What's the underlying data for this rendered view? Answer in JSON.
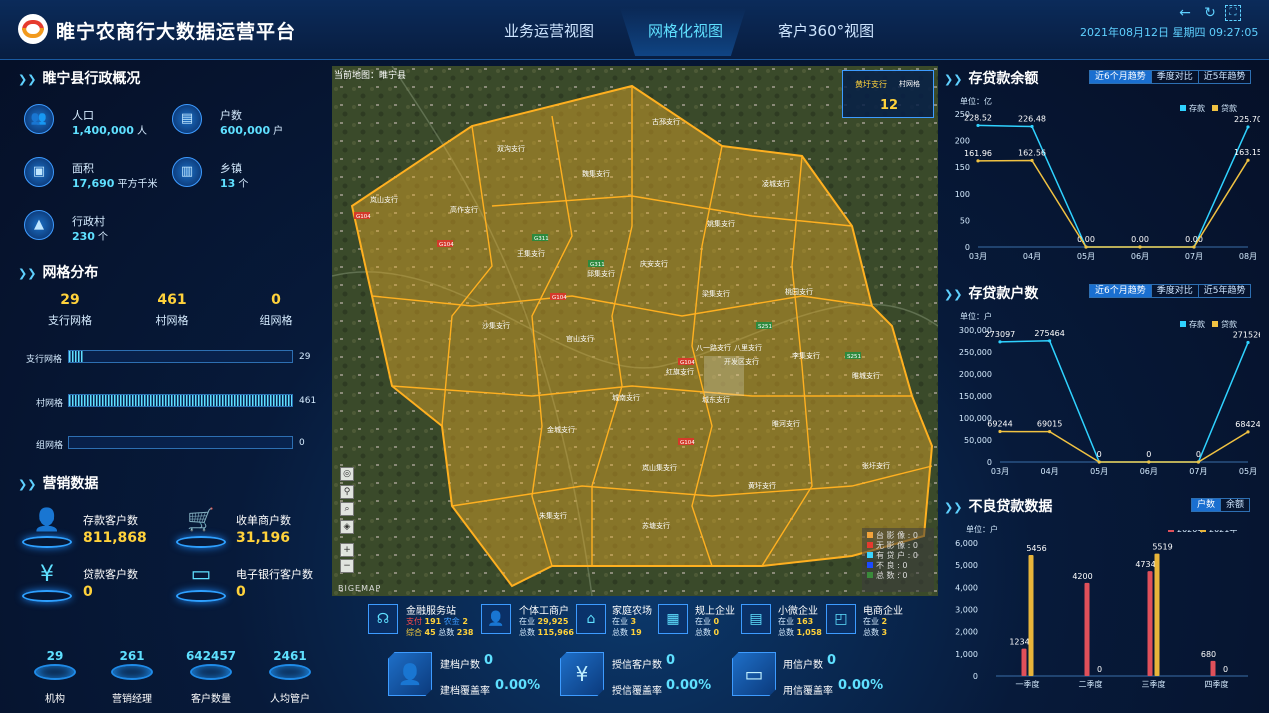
{
  "header": {
    "title": "睢宁农商行大数据运营平台",
    "tabs": [
      {
        "label": "业务运营视图"
      },
      {
        "label": "网格化视图"
      },
      {
        "label": "客户360°视图"
      }
    ],
    "active_tab": 1,
    "datetime": "2021年08月12日 星期四 09:27:05",
    "icons": [
      "back-icon",
      "refresh-icon",
      "fullscreen-icon"
    ]
  },
  "admin": {
    "title": "睢宁县行政概况",
    "stats": [
      {
        "label": "人口",
        "value": "1,400,000",
        "unit": "人",
        "icon": "people-icon"
      },
      {
        "label": "户数",
        "value": "600,000",
        "unit": "户",
        "icon": "household-card-icon"
      },
      {
        "label": "面积",
        "value": "17,690",
        "unit": "平方千米",
        "icon": "area-icon"
      },
      {
        "label": "乡镇",
        "value": "13",
        "unit": "个",
        "icon": "town-icon"
      },
      {
        "label": "行政村",
        "value": "230",
        "unit": "个",
        "icon": "village-icon"
      }
    ]
  },
  "grid": {
    "title": "网格分布",
    "summary": [
      {
        "value": "29",
        "label": "支行网格"
      },
      {
        "value": "461",
        "label": "村网格"
      },
      {
        "value": "0",
        "label": "组网格"
      }
    ],
    "bars": [
      {
        "label": "支行网格",
        "value": 29,
        "display": "29"
      },
      {
        "label": "村网格",
        "value": 461,
        "display": "461"
      },
      {
        "label": "组网格",
        "value": 0,
        "display": "0"
      }
    ],
    "bar_max": 461
  },
  "marketing": {
    "title": "营销数据",
    "items": [
      {
        "label": "存款客户数",
        "value": "811,868",
        "icon": "deposit-customer-icon"
      },
      {
        "label": "收单商户数",
        "value": "31,196",
        "icon": "merchant-icon"
      },
      {
        "label": "贷款客户数",
        "value": "0",
        "icon": "loan-customer-icon"
      },
      {
        "label": "电子银行客户数",
        "value": "0",
        "icon": "e-bank-card-icon"
      }
    ],
    "kpis": [
      {
        "value": "29",
        "label": "机构"
      },
      {
        "value": "261",
        "label": "营销经理"
      },
      {
        "value": "642457",
        "label": "客户数量"
      },
      {
        "value": "2461",
        "label": "人均管户"
      }
    ]
  },
  "map": {
    "caption": "当前地图：睢宁县",
    "box_labels": [
      "黄圩支行",
      "村网格"
    ],
    "box_value": "12",
    "branches": [
      "古邳支行",
      "魏集支行",
      "双沟支行",
      "岚山支行",
      "高作支行",
      "王集支行",
      "庆安支行",
      "姚集支行",
      "凌城支行",
      "邱集支行",
      "沙集支行",
      "梁集支行",
      "桃园支行",
      "官山支行",
      "李集支行",
      "睢城支行",
      "八一路支行",
      "八里支行",
      "开发区支行",
      "红旗支行",
      "城东支行",
      "城南支行",
      "金城支行",
      "睢河支行",
      "岚山集支行",
      "张圩支行",
      "黄圩支行",
      "朱集支行",
      "苏塘支行"
    ],
    "roads": [
      "G104",
      "G311",
      "G311",
      "G104",
      "G104",
      "S251",
      "G104",
      "S251",
      "G104"
    ],
    "legend": [
      {
        "label": "台 影 像",
        "value": "0",
        "color": "#f2a23a"
      },
      {
        "label": "无 影 像",
        "value": "0",
        "color": "#e53a2e"
      },
      {
        "label": "有 贷 户",
        "value": "0",
        "color": "#3ad4ff"
      },
      {
        "label": "不      良",
        "value": "0",
        "color": "#1a4aff"
      },
      {
        "label": "总      数",
        "value": "0",
        "color": "#3a8a3a"
      }
    ],
    "watermark": "BIGEMAP",
    "tool_icons": [
      "locate-icon",
      "pin-icon",
      "search-pin-icon",
      "layers-icon",
      "zoom-in-icon",
      "zoom-out-icon"
    ],
    "zoom_labels": [
      "+",
      "−"
    ]
  },
  "services": [
    {
      "title": "金融服务站",
      "lines": [
        {
          "k1": "支付",
          "v1": "191",
          "k2": "农金",
          "v2": "2"
        },
        {
          "k1": "综合",
          "v1": "45",
          "k2": "总数",
          "v2": "238"
        }
      ],
      "icon": "headset-icon"
    },
    {
      "title": "个体工商户",
      "lines": [
        {
          "k1": "在业",
          "v1": "29,925"
        },
        {
          "k1": "总数",
          "v1": "115,966"
        }
      ],
      "icon": "person-icon"
    },
    {
      "title": "家庭农场",
      "lines": [
        {
          "k1": "在业",
          "v1": "3"
        },
        {
          "k1": "总数",
          "v1": "19"
        }
      ],
      "icon": "farm-icon"
    },
    {
      "title": "规上企业",
      "lines": [
        {
          "k1": "在业",
          "v1": "0"
        },
        {
          "k1": "总数",
          "v1": "0"
        }
      ],
      "icon": "building-icon"
    },
    {
      "title": "小微企业",
      "lines": [
        {
          "k1": "在业",
          "v1": "163"
        },
        {
          "k1": "总数",
          "v1": "1,058"
        }
      ],
      "icon": "small-biz-icon"
    },
    {
      "title": "电商企业",
      "lines": [
        {
          "k1": "在业",
          "v1": "2"
        },
        {
          "k1": "总数",
          "v1": "3"
        }
      ],
      "icon": "shopping-bag-icon"
    }
  ],
  "coverage": [
    {
      "label1": "建档户数",
      "value1": "0",
      "label2": "建档覆盖率",
      "value2": "0.00%",
      "icon": "user-file-icon"
    },
    {
      "label1": "授信客户数",
      "value1": "0",
      "label2": "授信覆盖率",
      "value2": "0.00%",
      "icon": "coins-hand-icon"
    },
    {
      "label1": "用信户数",
      "value1": "0",
      "label2": "用信覆盖率",
      "value2": "0.00%",
      "icon": "card-icon"
    }
  ],
  "deposit_balance": {
    "title": "存贷款余额",
    "buttons": [
      "近6个月趋势",
      "季度对比",
      "近5年趋势"
    ],
    "active": 0,
    "unit": "单位：亿"
  },
  "deposit_households": {
    "title": "存贷款户数",
    "buttons": [
      "近6个月趋势",
      "季度对比",
      "近5年趋势"
    ],
    "active": 0,
    "unit": "单位：户"
  },
  "npl": {
    "title": "不良贷款数据",
    "buttons": [
      "户数",
      "余额"
    ],
    "active": 0,
    "unit": "单位：户"
  },
  "chart_data": [
    {
      "type": "line",
      "categories": [
        "03月",
        "04月",
        "05月",
        "06月",
        "07月",
        "08月"
      ],
      "series": [
        {
          "name": "存款",
          "values": [
            228.52,
            226.48,
            0.0,
            0.0,
            0.0,
            225.7
          ],
          "labels": [
            "228.52",
            "226.48",
            "0.00",
            "0.00",
            "0.00",
            "225.70"
          ],
          "color": "#2fd2ff"
        },
        {
          "name": "贷款",
          "values": [
            161.96,
            162.56,
            0.0,
            0.0,
            0.0,
            163.15
          ],
          "labels": [
            "161.96",
            "162.56",
            "",
            "",
            "",
            "163.15"
          ],
          "color": "#f0c242"
        }
      ],
      "ylim": [
        0,
        250
      ],
      "yticks": [
        "0",
        "50",
        "100",
        "150",
        "200",
        "250"
      ],
      "grid": false,
      "legend": "top-right"
    },
    {
      "type": "line",
      "categories": [
        "03月",
        "04月",
        "05月",
        "06月",
        "07月",
        "05月"
      ],
      "series": [
        {
          "name": "存款",
          "values": [
            273097,
            275464,
            0,
            0,
            0,
            271526
          ],
          "labels": [
            "273097",
            "275464",
            "0",
            "0",
            "0",
            "271526"
          ],
          "color": "#2fd2ff"
        },
        {
          "name": "贷款",
          "values": [
            69244,
            69015,
            0,
            0,
            0,
            68424
          ],
          "labels": [
            "69244",
            "69015",
            "",
            "",
            "",
            "68424"
          ],
          "color": "#f0c242"
        }
      ],
      "ylim": [
        0,
        300000
      ],
      "yticks": [
        "0",
        "50,000",
        "100,000",
        "150,000",
        "200,000",
        "250,000",
        "300,000"
      ],
      "grid": false,
      "legend": "top-right"
    },
    {
      "type": "bar",
      "categories": [
        "一季度",
        "二季度",
        "三季度",
        "四季度"
      ],
      "series": [
        {
          "name": "2020年",
          "values": [
            1234,
            4200,
            4734,
            680
          ],
          "labels": [
            "1234",
            "4200",
            "4734",
            "680"
          ],
          "color": "#e0505a"
        },
        {
          "name": "2021年",
          "values": [
            5456,
            0,
            5519,
            0
          ],
          "labels": [
            "5456",
            "0",
            "5519",
            "0"
          ],
          "color": "#e8b53a"
        }
      ],
      "ylim": [
        0,
        6000
      ],
      "yticks": [
        "0",
        "1,000",
        "2,000",
        "3,000",
        "4,000",
        "5,000",
        "6,000"
      ],
      "grid": false,
      "legend": "top-right"
    }
  ]
}
